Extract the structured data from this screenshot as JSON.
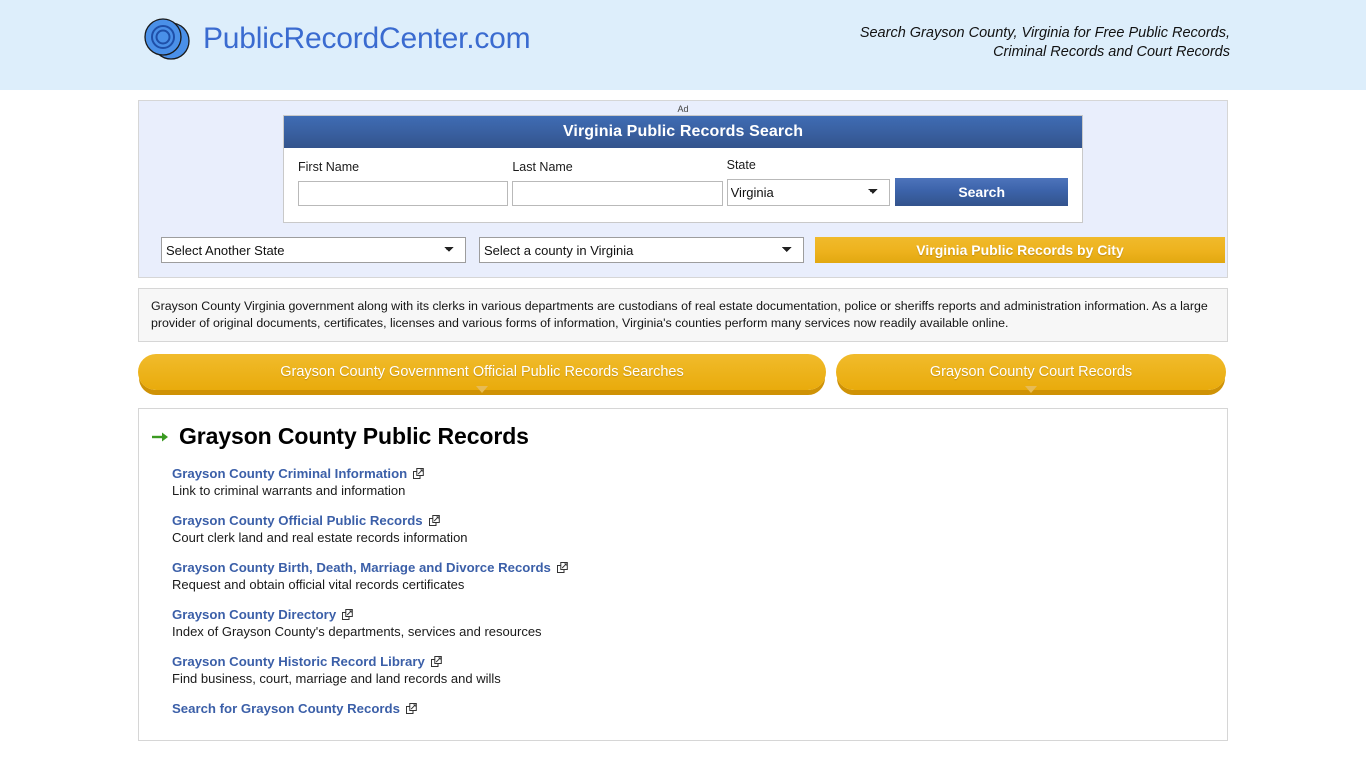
{
  "header": {
    "brand_name": "PublicRecordCenter.com",
    "logo_icon": "overlapping-circles-logo",
    "tagline": "Search Grayson County, Virginia for Free Public Records, Criminal Records and Court Records",
    "background_color": "#ddeefb",
    "brand_color": "#3a6bd0"
  },
  "ad": {
    "label": "Ad",
    "search_card": {
      "title": "Virginia Public Records Search",
      "title_bg_color": "#3a5f9f",
      "fields": [
        {
          "label": "First Name",
          "value": "",
          "placeholder": ""
        },
        {
          "label": "Last Name",
          "value": "",
          "placeholder": ""
        }
      ],
      "state_field": {
        "label": "State",
        "selected": "Virginia",
        "options": [
          "Virginia"
        ]
      },
      "search_button": "Search"
    }
  },
  "selectors": {
    "state_select": {
      "selected": "Select Another State",
      "options": [
        "Select Another State"
      ]
    },
    "county_select": {
      "selected": "Select a county in Virginia",
      "options": [
        "Select a county in Virginia"
      ]
    },
    "city_button": "Virginia Public Records by City",
    "gold_color": "#eeb31f"
  },
  "description": {
    "text": "Grayson County Virginia government along with its clerks in various departments are custodians of real estate documentation, police or sheriffs reports and administration information. As a large provider of original documents, certificates, licenses and various forms of information, Virginia's counties perform many services now readily available online."
  },
  "pill_buttons": [
    {
      "label": "Grayson County Government Official Public Records Searches"
    },
    {
      "label": "Grayson County Court Records"
    }
  ],
  "records": {
    "heading": "Grayson County Public Records",
    "heading_icon": "green-arrow-icon",
    "links": [
      {
        "title": "Grayson County Criminal Information",
        "desc": "Link to criminal warrants and information",
        "icon": "external-link-icon"
      },
      {
        "title": "Grayson County Official Public Records",
        "desc": "Court clerk land and real estate records information",
        "icon": "external-link-icon"
      },
      {
        "title": "Grayson County Birth, Death, Marriage and Divorce Records",
        "desc": "Request and obtain official vital records certificates",
        "icon": "external-link-icon"
      },
      {
        "title": "Grayson County Directory",
        "desc": "Index of Grayson County's departments, services and resources",
        "icon": "external-link-icon"
      },
      {
        "title": "Grayson County Historic Record Library",
        "desc": "Find business, court, marriage and land records and wills",
        "icon": "external-link-icon"
      },
      {
        "title": "Search for Grayson County Records",
        "desc": "",
        "icon": "external-link-icon"
      }
    ]
  }
}
